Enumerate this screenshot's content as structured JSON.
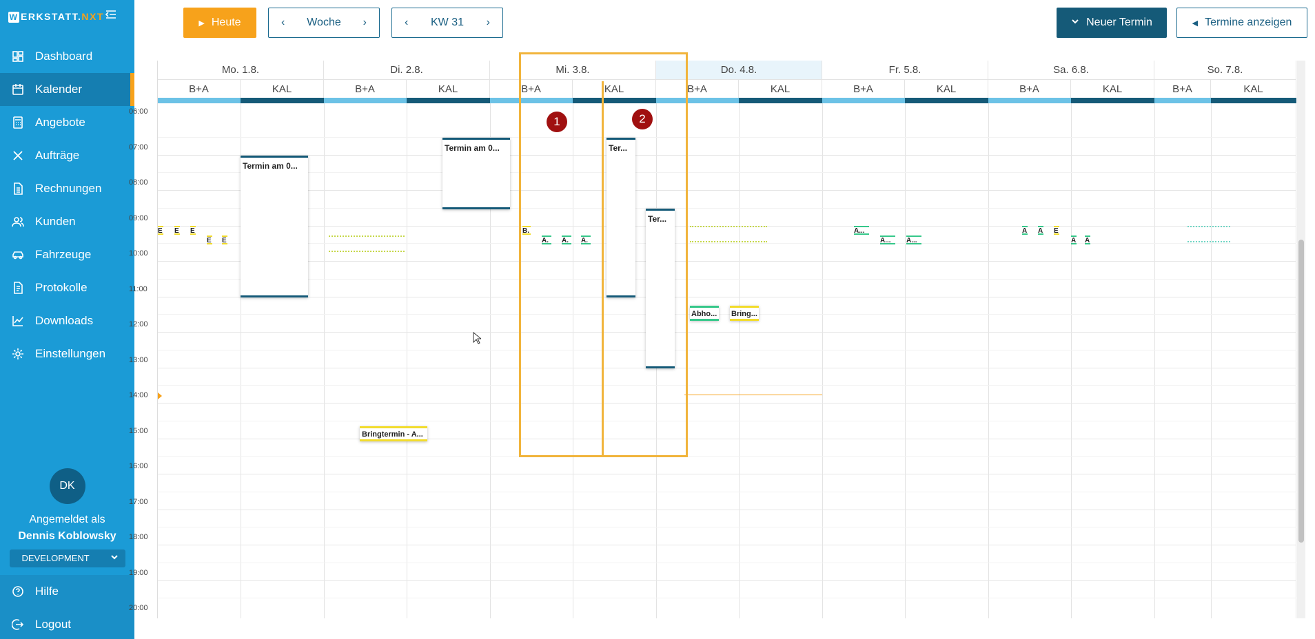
{
  "brand": {
    "prefix": "W",
    "name": "ERKSTATT.",
    "suffix": "NXT"
  },
  "sidebar": {
    "items": [
      {
        "label": "Dashboard",
        "icon": "dashboard-icon"
      },
      {
        "label": "Kalender",
        "icon": "calendar-icon",
        "active": true
      },
      {
        "label": "Angebote",
        "icon": "calculator-icon"
      },
      {
        "label": "Aufträge",
        "icon": "tools-icon"
      },
      {
        "label": "Rechnungen",
        "icon": "invoice-icon"
      },
      {
        "label": "Kunden",
        "icon": "users-icon"
      },
      {
        "label": "Fahrzeuge",
        "icon": "car-icon"
      },
      {
        "label": "Protokolle",
        "icon": "protocol-icon"
      },
      {
        "label": "Downloads",
        "icon": "chart-icon"
      },
      {
        "label": "Einstellungen",
        "icon": "gear-icon"
      }
    ],
    "user": {
      "initials": "DK",
      "logged_in_as": "Angemeldet als",
      "name": "Dennis Koblowsky",
      "environment": "DEVELOPMENT"
    },
    "footer": [
      {
        "label": "Hilfe",
        "icon": "help-icon"
      },
      {
        "label": "Logout",
        "icon": "logout-icon"
      }
    ]
  },
  "toolbar": {
    "today": "Heute",
    "view": "Woche",
    "week": "KW 31",
    "new_appointment": "Neuer Termin",
    "show_appointments": "Termine anzeigen"
  },
  "calendar": {
    "days": [
      "Mo. 1.8.",
      "Di. 2.8.",
      "Mi. 3.8.",
      "Do. 4.8.",
      "Fr. 5.8.",
      "Sa. 6.8.",
      "So. 7.8."
    ],
    "today_index": 3,
    "resources": [
      "B+A",
      "KAL"
    ],
    "hours": [
      "06:00",
      "07:00",
      "08:00",
      "09:00",
      "10:00",
      "11:00",
      "12:00",
      "13:00",
      "14:00",
      "15:00",
      "16:00",
      "17:00",
      "18:00",
      "19:00",
      "20:00"
    ],
    "events": {
      "mo_kal": "Termin am 0...",
      "di_kal": "Termin am 0...",
      "di_ba": "Bringtermin - A...",
      "mi_kal_1": "Ter...",
      "mi_kal_2": "Ter...",
      "mi_ba_b": "B.",
      "mi_ba_a": "A.",
      "do_ba_1": "Abho...",
      "do_ba_2": "Bring...",
      "fr_ba_a": "A...",
      "mo_ba_e": "E",
      "sa_ba_a": "A",
      "sa_ba_e": "E"
    },
    "markers": [
      "1",
      "2"
    ]
  },
  "colors": {
    "sidebar": "#1b9bd6",
    "accent": "#f7a21b",
    "dark": "#155a78",
    "marker": "#a01010"
  }
}
